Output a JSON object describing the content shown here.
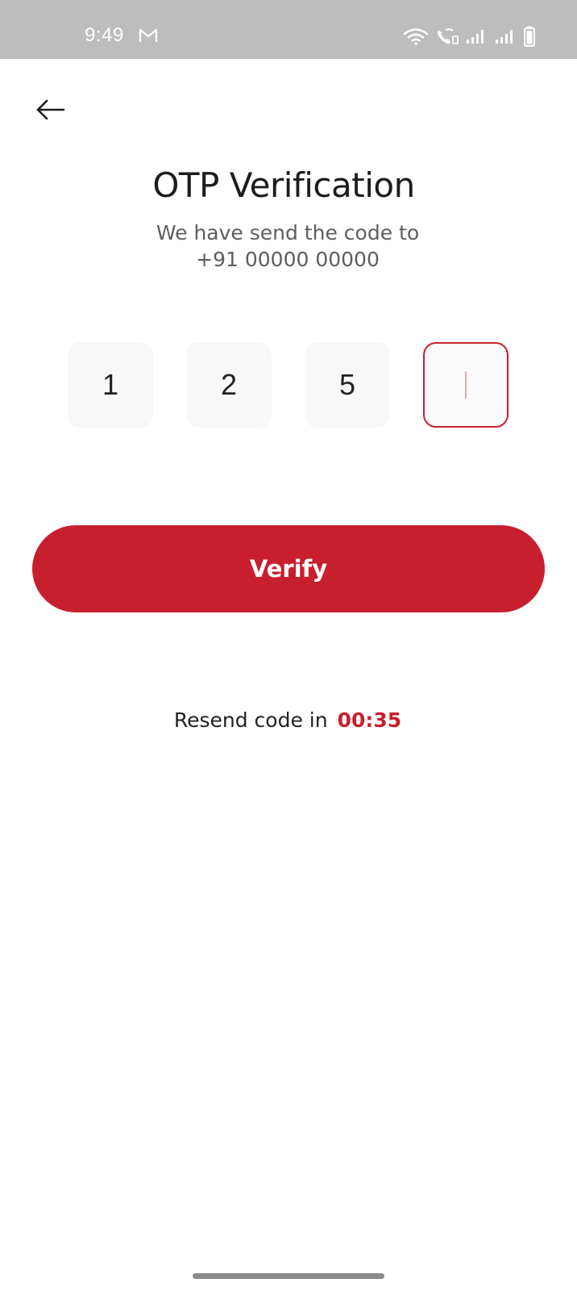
{
  "status_bar": {
    "time": "9:49"
  },
  "header": {
    "title": "OTP Verification",
    "subtitle_line1": "We have send the code to",
    "subtitle_line2": "+91 00000 00000"
  },
  "otp": {
    "digits": [
      "1",
      "2",
      "5",
      ""
    ],
    "active_index": 3
  },
  "actions": {
    "verify_label": "Verify"
  },
  "resend": {
    "label": "Resend code in",
    "timer": "00:35"
  },
  "colors": {
    "accent": "#c81f2e",
    "status_bar": "#bdbdbd",
    "otp_box": "#f8f8f8"
  },
  "icons": {
    "back": "arrow-left-icon",
    "gmail": "gmail-icon",
    "wifi": "wifi-icon",
    "wifi_call": "wifi-call-icon",
    "signal": "signal-icon",
    "battery": "battery-icon"
  }
}
